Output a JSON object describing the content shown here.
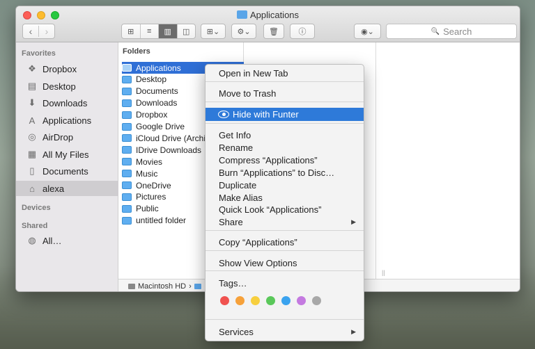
{
  "window": {
    "title": "Applications"
  },
  "toolbar": {
    "back": "‹",
    "forward": "›",
    "view_icons": "⊞",
    "view_list": "≡",
    "view_columns": "▥",
    "view_coverflow": "◫",
    "arrange": "⊞⌄",
    "action": "⚙⌄",
    "trash": "🗑",
    "info": "ⓘ",
    "funter": "◉⌄",
    "search_placeholder": "Search",
    "search_icon": "🔍"
  },
  "sidebar": {
    "favorites_header": "Favorites",
    "devices_header": "Devices",
    "shared_header": "Shared",
    "items": [
      {
        "label": "Dropbox",
        "icon": "dropbox-icon",
        "glyph": "❖"
      },
      {
        "label": "Desktop",
        "icon": "desktop-icon",
        "glyph": "▤"
      },
      {
        "label": "Downloads",
        "icon": "downloads-icon",
        "glyph": "⬇"
      },
      {
        "label": "Applications",
        "icon": "applications-icon",
        "glyph": "A"
      },
      {
        "label": "AirDrop",
        "icon": "airdrop-icon",
        "glyph": "◎"
      },
      {
        "label": "All My Files",
        "icon": "all-my-files-icon",
        "glyph": "▦"
      },
      {
        "label": "Documents",
        "icon": "documents-icon",
        "glyph": "▯"
      },
      {
        "label": "alexa",
        "icon": "home-icon",
        "glyph": "⌂"
      }
    ],
    "shared_items": [
      {
        "label": "All…",
        "icon": "network-icon",
        "glyph": "◍"
      }
    ]
  },
  "column1": {
    "header": "Folders",
    "items": [
      "Applications",
      "Desktop",
      "Documents",
      "Downloads",
      "Dropbox",
      "Google Drive",
      "iCloud Drive (Archive)",
      "IDrive Downloads",
      "Movies",
      "Music",
      "OneDrive",
      "Pictures",
      "Public",
      "untitled folder"
    ]
  },
  "pathbar": {
    "drive": "Macintosh HD",
    "separator": "›"
  },
  "context_menu": {
    "items": [
      "Open in New Tab",
      "Move to Trash",
      "Hide with Funter",
      "Get Info",
      "Rename",
      "Compress “Applications”",
      "Burn “Applications” to Disc…",
      "Duplicate",
      "Make Alias",
      "Quick Look “Applications”",
      "Share",
      "Copy “Applications”",
      "Show View Options",
      "Tags…",
      "Services"
    ],
    "submenu_arrow": "▶",
    "tag_colors": [
      "#f0524f",
      "#f6a13a",
      "#f7cf3e",
      "#5ac85a",
      "#3aa3ef",
      "#c47ae0",
      "#a8a8a8"
    ]
  }
}
